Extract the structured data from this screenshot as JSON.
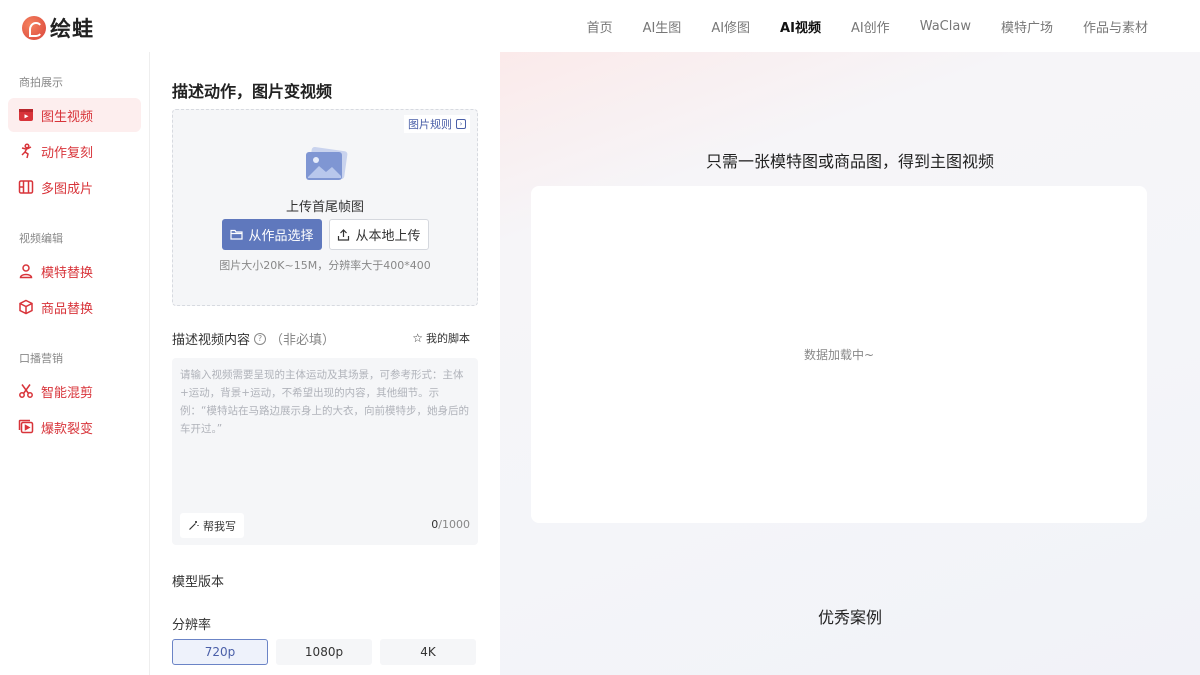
{
  "header": {
    "logo_text": "绘蛙",
    "nav": [
      "首页",
      "AI生图",
      "AI修图",
      "AI视频",
      "AI创作",
      "WaClaw",
      "模特广场",
      "作品与素材"
    ],
    "active_nav": "AI视频"
  },
  "sidebar": {
    "sections": [
      {
        "title": "商拍展示",
        "items": [
          {
            "label": "图生视频",
            "icon": "video-play-icon",
            "active": true
          },
          {
            "label": "动作复刻",
            "icon": "dance-figure-icon",
            "active": false
          },
          {
            "label": "多图成片",
            "icon": "film-layout-icon",
            "active": false
          }
        ]
      },
      {
        "title": "视频编辑",
        "items": [
          {
            "label": "模特替换",
            "icon": "person-icon",
            "active": false
          },
          {
            "label": "商品替换",
            "icon": "cube-icon",
            "active": false
          }
        ]
      },
      {
        "title": "口播营销",
        "items": [
          {
            "label": "智能混剪",
            "icon": "scissors-icon",
            "active": false
          },
          {
            "label": "爆款裂变",
            "icon": "copy-play-icon",
            "active": false
          }
        ]
      }
    ]
  },
  "panel": {
    "title": "描述动作，图片变视频",
    "upload": {
      "rule_link": "图片规则",
      "label": "上传首尾帧图",
      "btn_works": "从作品选择",
      "btn_local": "从本地上传",
      "hint": "图片大小20K~15M，分辨率大于400*400"
    },
    "description": {
      "label": "描述视频内容",
      "optional": "（非必填）",
      "my_script": "我的脚本",
      "placeholder": "请输入视频需要呈现的主体运动及其场景，可参考形式：主体+运动，背景+运动，不希望出现的内容，其他细节。示例：“模特站在马路边展示身上的大衣，向前模特步，她身后的车开过。”",
      "value": "",
      "help_write": "帮我写",
      "count": "0",
      "max": "/1000"
    },
    "model_label": "模型版本",
    "resolution": {
      "label": "分辨率",
      "options": [
        "720p",
        "1080p",
        "4K"
      ],
      "selected": "720p"
    }
  },
  "right": {
    "title": "只需一张模特图或商品图，得到主图视频",
    "loading": "数据加载中~",
    "cases_title": "优秀案例"
  },
  "colors": {
    "brand_red": "#d8343a",
    "primary_blue": "#5f78bd",
    "active_bg": "#fdeeee"
  }
}
